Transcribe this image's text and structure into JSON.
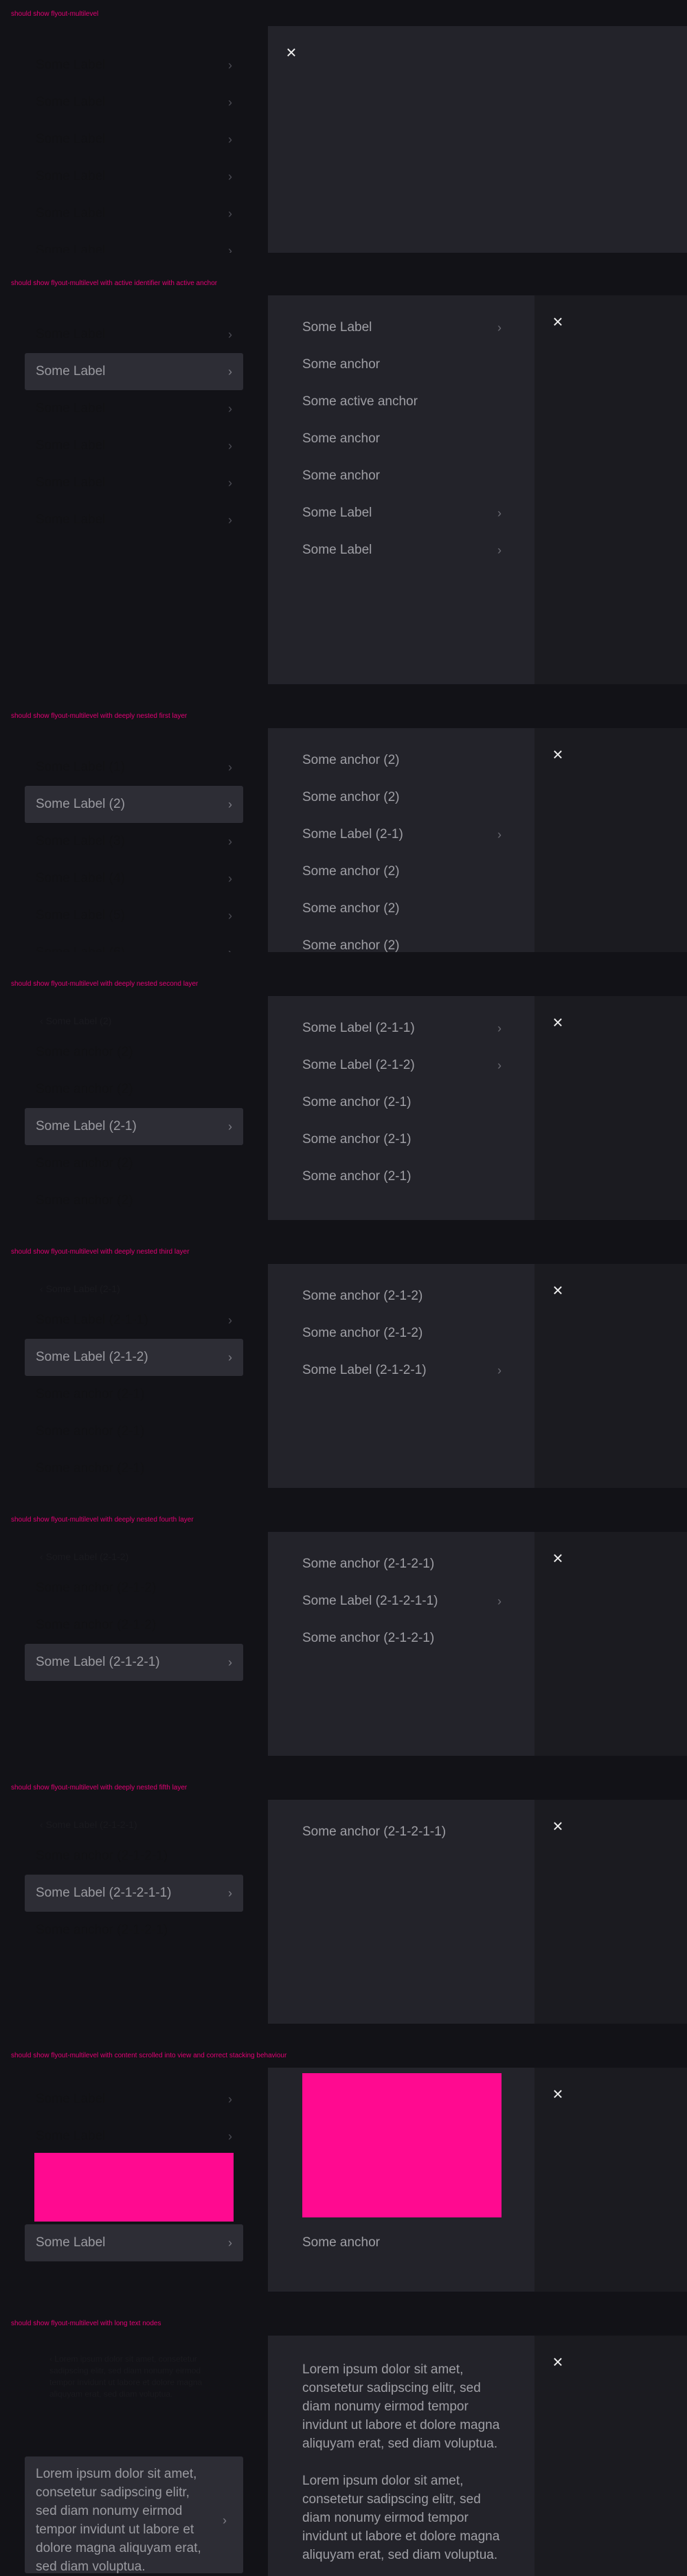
{
  "sections": [
    {
      "heading": "should show flyout-multilevel",
      "close_icon": "close-icon",
      "left_rows": [
        {
          "label": "Some Label",
          "chevron": true
        },
        {
          "label": "Some Label",
          "chevron": true
        },
        {
          "label": "Some Label",
          "chevron": true
        },
        {
          "label": "Some Label",
          "chevron": true
        },
        {
          "label": "Some Label",
          "chevron": true
        },
        {
          "label": "Some Label",
          "chevron": true
        }
      ]
    },
    {
      "heading": "should show flyout-multilevel with active identifier with active anchor",
      "close_icon": "close-icon",
      "left_rows": [
        {
          "label": "Some Label",
          "chevron": true
        },
        {
          "label": "Some Label",
          "chevron": true,
          "active": true
        },
        {
          "label": "Some Label",
          "chevron": true
        },
        {
          "label": "Some Label",
          "chevron": true
        },
        {
          "label": "Some Label",
          "chevron": true
        },
        {
          "label": "Some Label",
          "chevron": true
        }
      ],
      "panel_rows": [
        {
          "label": "Some Label",
          "chevron": true
        },
        {
          "label": "Some anchor",
          "chevron": false
        },
        {
          "label": "Some active anchor",
          "chevron": false
        },
        {
          "label": "Some anchor",
          "chevron": false
        },
        {
          "label": "Some anchor",
          "chevron": false
        },
        {
          "label": "Some Label",
          "chevron": true
        },
        {
          "label": "Some Label",
          "chevron": true
        }
      ]
    },
    {
      "heading": "should show flyout-multilevel with deeply nested first layer",
      "close_icon": "close-icon",
      "left_rows": [
        {
          "label": "Some Label (1)",
          "chevron": true
        },
        {
          "label": "Some Label (2)",
          "chevron": true,
          "active": true
        },
        {
          "label": "Some Label (3)",
          "chevron": true
        },
        {
          "label": "Some Label (4)",
          "chevron": true
        },
        {
          "label": "Some Label (5)",
          "chevron": true
        },
        {
          "label": "Some Label (6)",
          "chevron": true
        }
      ],
      "panel_rows": [
        {
          "label": "Some anchor (2)",
          "chevron": false
        },
        {
          "label": "Some anchor (2)",
          "chevron": false
        },
        {
          "label": "Some Label (2-1)",
          "chevron": true
        },
        {
          "label": "Some anchor (2)",
          "chevron": false
        },
        {
          "label": "Some anchor (2)",
          "chevron": false
        },
        {
          "label": "Some anchor (2)",
          "chevron": false
        }
      ]
    },
    {
      "heading": "should show flyout-multilevel with deeply nested second layer",
      "close_icon": "close-icon",
      "back_label": "Some Label (2)",
      "left_rows": [
        {
          "label": "Some anchor (2)",
          "chevron": false
        },
        {
          "label": "Some anchor (2)",
          "chevron": false
        },
        {
          "label": "Some Label (2-1)",
          "chevron": true,
          "active": true
        },
        {
          "label": "Some anchor (2)",
          "chevron": false
        },
        {
          "label": "Some anchor (2)",
          "chevron": false
        }
      ],
      "panel_rows": [
        {
          "label": "Some Label (2-1-1)",
          "chevron": true
        },
        {
          "label": "Some Label (2-1-2)",
          "chevron": true
        },
        {
          "label": "Some anchor (2-1)",
          "chevron": false
        },
        {
          "label": "Some anchor (2-1)",
          "chevron": false
        },
        {
          "label": "Some anchor (2-1)",
          "chevron": false
        }
      ]
    },
    {
      "heading": "should show flyout-multilevel with deeply nested third layer",
      "close_icon": "close-icon",
      "back_label": "Some Label (2-1)",
      "left_rows": [
        {
          "label": "Some Label (2-1-1)",
          "chevron": true
        },
        {
          "label": "Some Label (2-1-2)",
          "chevron": true,
          "active": true
        },
        {
          "label": "Some anchor (2-1)",
          "chevron": false
        },
        {
          "label": "Some anchor (2-1)",
          "chevron": false
        },
        {
          "label": "Some anchor (2-1)",
          "chevron": false
        }
      ],
      "panel_rows": [
        {
          "label": "Some anchor (2-1-2)",
          "chevron": false
        },
        {
          "label": "Some anchor (2-1-2)",
          "chevron": false
        },
        {
          "label": "Some Label (2-1-2-1)",
          "chevron": true
        }
      ]
    },
    {
      "heading": "should show flyout-multilevel with deeply nested fourth layer",
      "close_icon": "close-icon",
      "back_label": "Some Label (2-1-2)",
      "left_rows": [
        {
          "label": "Some anchor (2-1-2)",
          "chevron": false
        },
        {
          "label": "Some anchor (2-1-2)",
          "chevron": false
        },
        {
          "label": "Some Label (2-1-2-1)",
          "chevron": true,
          "active": true
        }
      ],
      "panel_rows": [
        {
          "label": "Some anchor (2-1-2-1)",
          "chevron": false
        },
        {
          "label": "Some Label (2-1-2-1-1)",
          "chevron": true
        },
        {
          "label": "Some anchor (2-1-2-1)",
          "chevron": false
        }
      ]
    },
    {
      "heading": "should show flyout-multilevel with deeply nested fifth layer",
      "close_icon": "close-icon",
      "back_label": "Some Label (2-1-2-1)",
      "left_rows": [
        {
          "label": "Some anchor (2-1-2-1)",
          "chevron": false
        },
        {
          "label": "Some Label (2-1-2-1-1)",
          "chevron": true,
          "active": true
        },
        {
          "label": "Some anchor (2-1-2-1)",
          "chevron": false
        }
      ],
      "panel_rows": [
        {
          "label": "Some anchor (2-1-2-1-1)",
          "chevron": false
        }
      ]
    },
    {
      "heading": "should show flyout-multilevel with content scrolled into view and correct stacking behaviour",
      "close_icon": "close-icon",
      "left_rows": [
        {
          "label": "Some Label",
          "chevron": true
        },
        {
          "label": "Some Label",
          "chevron": true
        },
        {
          "label": "Some Label",
          "chevron": true,
          "active": true
        }
      ],
      "panel_rows": [
        {
          "label": "Some anchor",
          "chevron": false
        }
      ]
    },
    {
      "heading": "should show flyout-multilevel with long text nodes",
      "close_icon": "close-icon",
      "left_dim_text": "Lorem ipsum dolor sit amet, consetetur sadipscing elitr, sed diam nonumy eirmod tempor invidunt ut labore et dolore magna aliquyam erat, sed diam voluptua.",
      "left_active_text": "Lorem ipsum dolor sit amet, consetetur sadipscing elitr, sed diam nonumy eirmod tempor invidunt ut labore et dolore magna aliquyam erat, sed diam voluptua.",
      "panel_text_1": "Lorem ipsum dolor sit amet, consetetur sadipscing elitr, sed diam nonumy eirmod tempor invidunt ut labore et dolore magna aliquyam erat, sed diam voluptua.",
      "panel_text_2": "Lorem ipsum dolor sit amet, consetetur sadipscing elitr, sed diam nonumy eirmod tempor invidunt ut labore et dolore magna aliquyam erat, sed diam voluptua."
    }
  ],
  "chevron_glyph": "›",
  "close_glyph": "×",
  "back_glyph": "‹"
}
